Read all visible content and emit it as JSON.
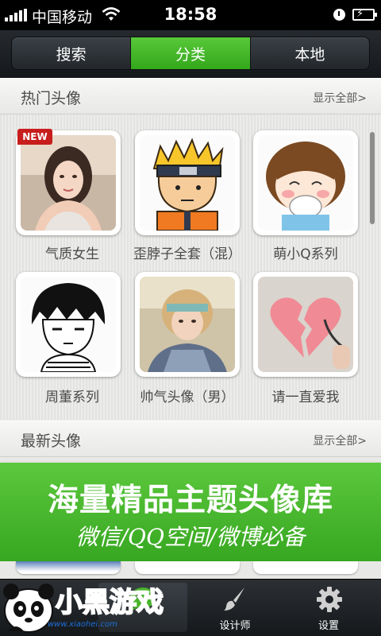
{
  "status_bar": {
    "carrier": "中国移动",
    "time": "18:58"
  },
  "top_tabs": [
    {
      "label": "搜索",
      "active": false
    },
    {
      "label": "分类",
      "active": true
    },
    {
      "label": "本地",
      "active": false
    }
  ],
  "hot_section": {
    "title": "热门头像",
    "more": "显示全部>",
    "badge": "NEW",
    "items": [
      {
        "label": "气质女生",
        "image": "girl-photo"
      },
      {
        "label": "歪脖子全套（混）",
        "image": "naruto-cartoon"
      },
      {
        "label": "萌小Q系列",
        "image": "cute-girl-cartoon"
      },
      {
        "label": "周董系列",
        "image": "boy-cartoon"
      },
      {
        "label": "帅气头像（男）",
        "image": "boy-photo"
      },
      {
        "label": "请一直爱我",
        "image": "broken-heart"
      }
    ]
  },
  "new_section": {
    "title": "最新头像",
    "more": "显示全部>"
  },
  "banner": {
    "title": "海量精品主题头像库",
    "subtitle": "微信/QQ空间/微博必备"
  },
  "bottom_tabs": [
    {
      "label": "",
      "icon": "wechat-icon",
      "active": true
    },
    {
      "label": "设计师",
      "icon": "brush-icon",
      "active": false
    },
    {
      "label": "设置",
      "icon": "gear-icon",
      "active": false
    }
  ],
  "watermark": {
    "text": "小黑游戏",
    "url": "www.xiaohei.com"
  },
  "colors": {
    "accent_green": "#3fb426",
    "dark_bar": "#1c1f22",
    "badge_red": "#c81d1d"
  }
}
